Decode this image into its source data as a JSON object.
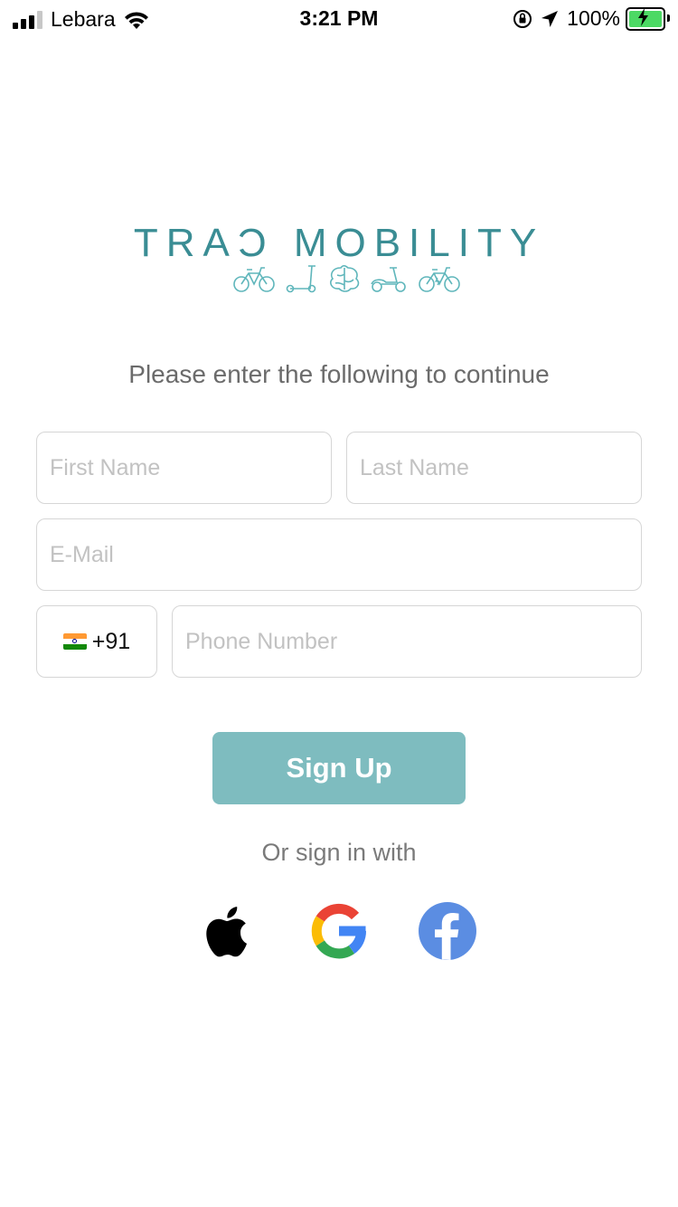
{
  "status_bar": {
    "carrier": "Lebara",
    "time": "3:21 PM",
    "battery_percent": "100%"
  },
  "logo": {
    "text": "TRAƆ MOBILITY",
    "color": "#3a8d94",
    "icons": [
      "bicycle-icon",
      "scooter-icon",
      "brain-icon",
      "moped-icon",
      "e-bike-icon"
    ]
  },
  "form": {
    "prompt": "Please enter the following to continue",
    "first_name_placeholder": "First Name",
    "last_name_placeholder": "Last Name",
    "email_placeholder": "E-Mail",
    "country_code": "+91",
    "country_flag": "india-flag-icon",
    "phone_placeholder": "Phone Number",
    "submit_label": "Sign Up",
    "submit_color": "#7ebcbf"
  },
  "social": {
    "prompt": "Or sign in with",
    "providers": [
      "apple-icon",
      "google-icon",
      "facebook-icon"
    ],
    "facebook_color": "#5b8de2"
  }
}
